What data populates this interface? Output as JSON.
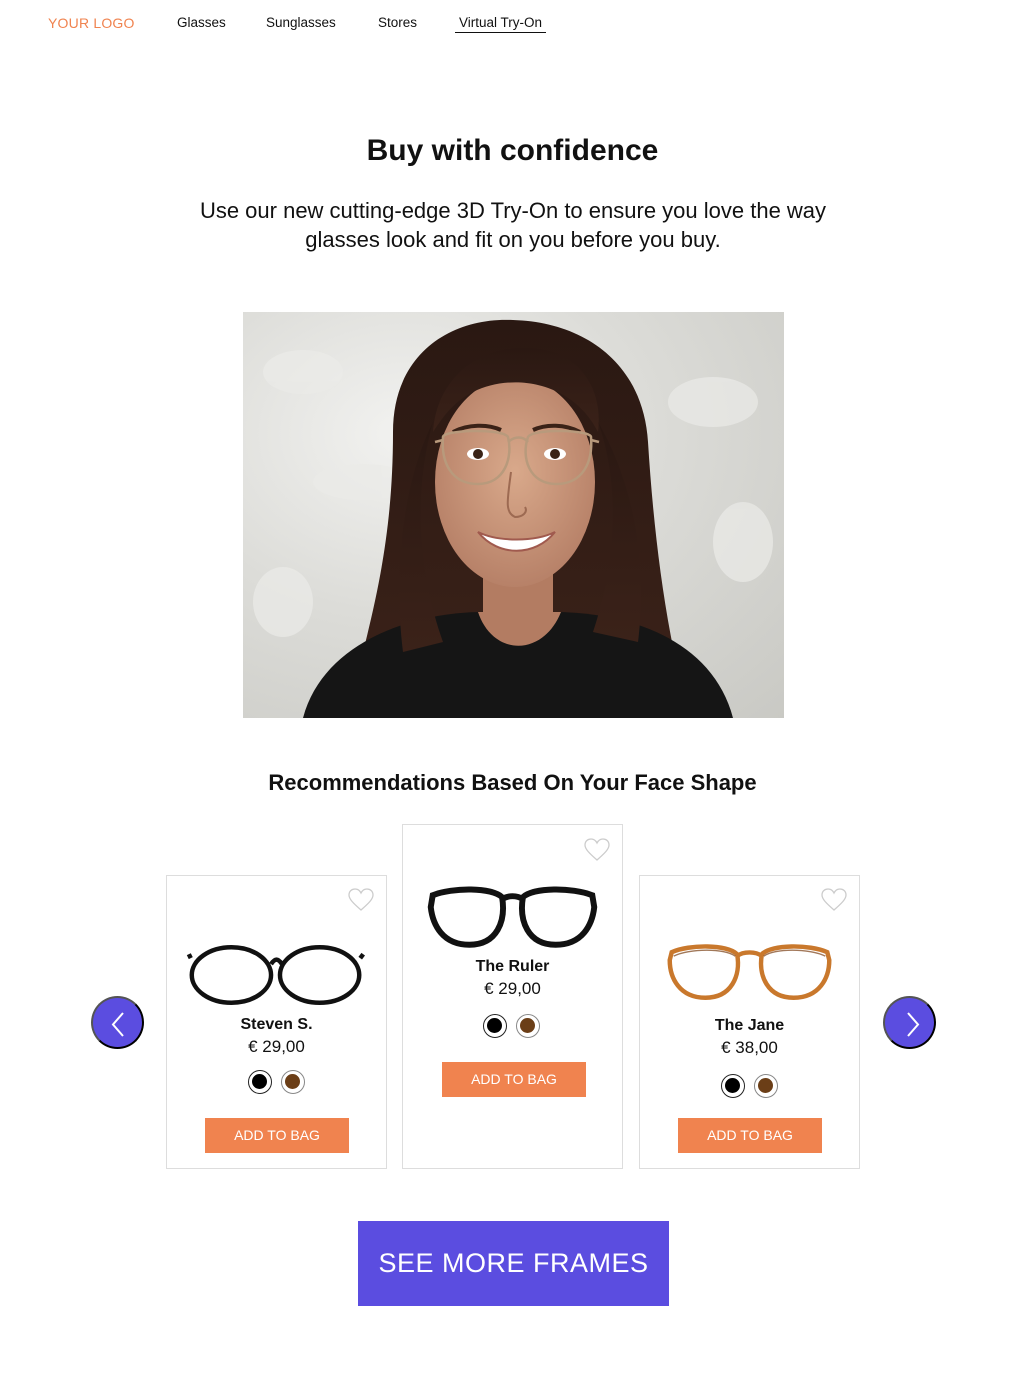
{
  "nav": {
    "logo": "YOUR LOGO",
    "links": [
      "Glasses",
      "Sunglasses",
      "Stores",
      "Virtual Try-On"
    ],
    "active_index": 3
  },
  "hero": {
    "title": "Buy with confidence",
    "subtitle": "Use our new cutting-edge 3D Try-On to ensure you love the way glasses look and fit on you before you buy."
  },
  "recommendations": {
    "title": "Recommendations Based On Your Face Shape",
    "products": [
      {
        "name": "Steven S.",
        "price": "€ 29,00",
        "button": "ADD TO BAG",
        "colors": [
          "#000000",
          "#6b3e17"
        ],
        "frame_style": "round-black"
      },
      {
        "name": "The Ruler",
        "price": "€ 29,00",
        "button": "ADD TO BAG",
        "colors": [
          "#000000",
          "#6b3e17"
        ],
        "frame_style": "cat-eye-black"
      },
      {
        "name": "The Jane",
        "price": "€ 38,00",
        "button": "ADD TO BAG",
        "colors": [
          "#000000",
          "#6b3e17"
        ],
        "frame_style": "round-tortoise"
      }
    ]
  },
  "cta": {
    "label": "SEE MORE FRAMES"
  },
  "colors": {
    "accent": "#f0834f",
    "primary": "#5b4de0"
  }
}
